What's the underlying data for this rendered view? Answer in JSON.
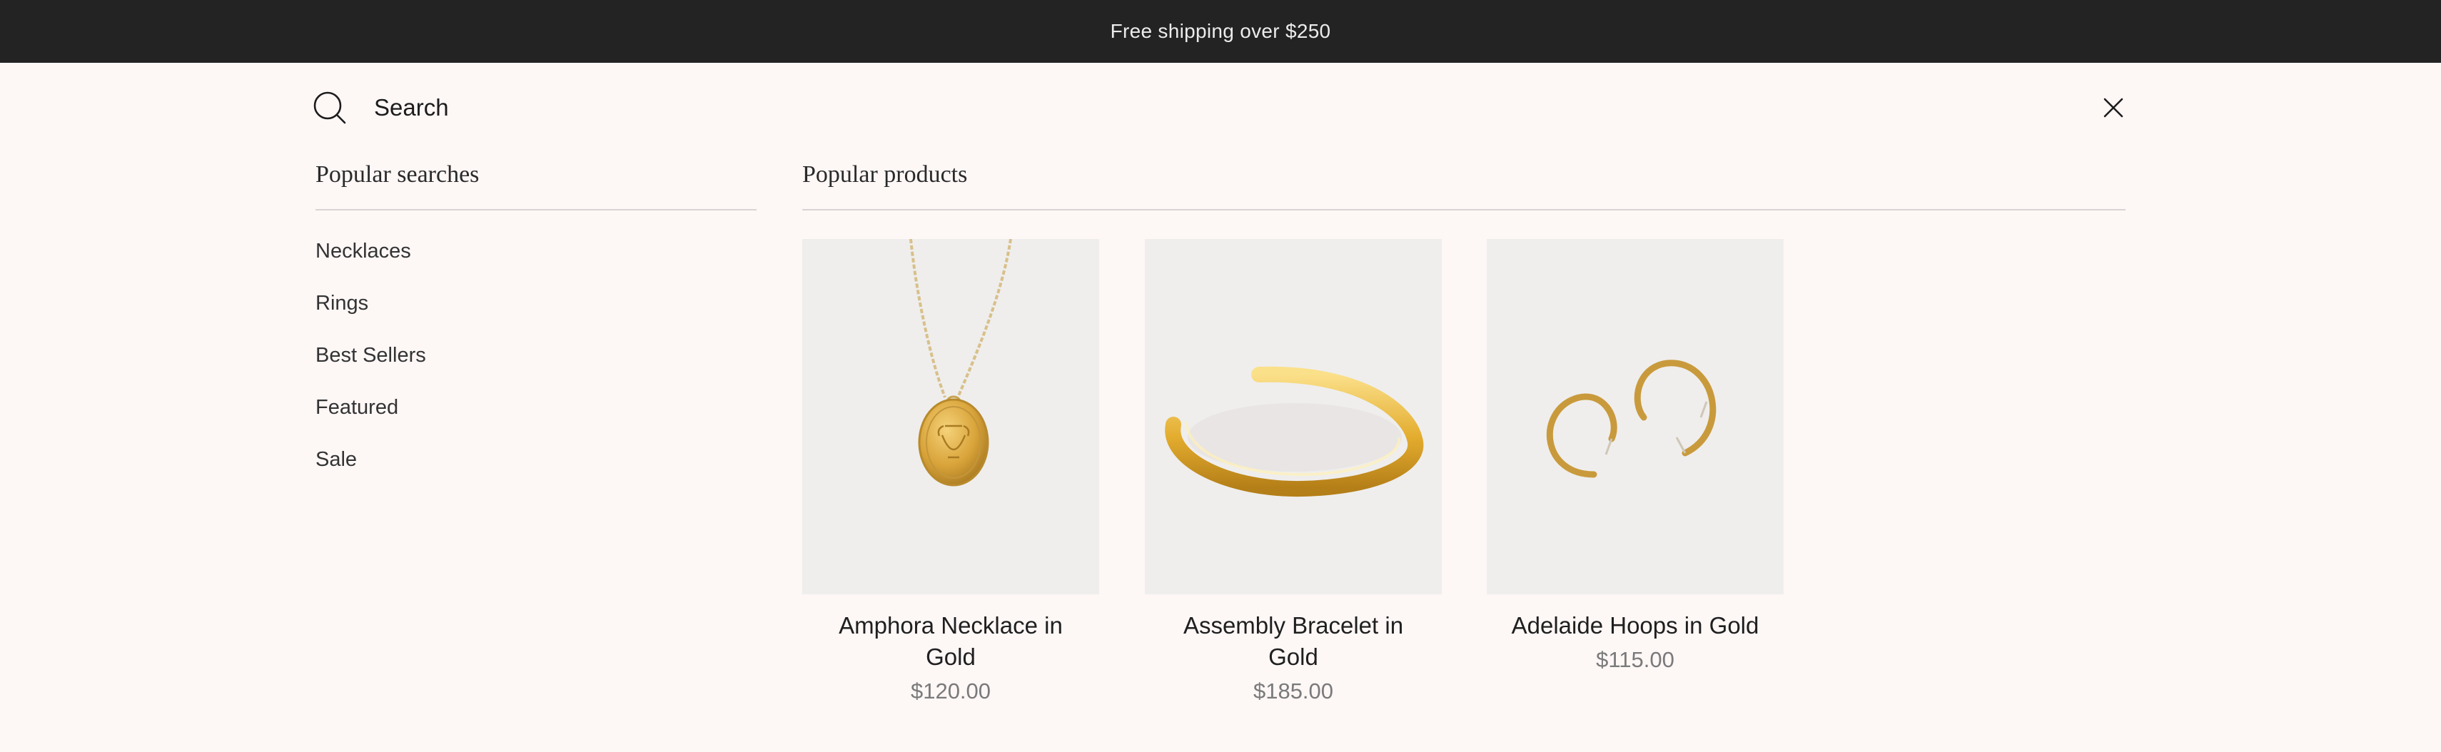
{
  "announcement": {
    "text": "Free shipping over $250"
  },
  "search": {
    "placeholder": "Search",
    "value": ""
  },
  "popular_searches": {
    "heading": "Popular searches",
    "items": [
      "Necklaces",
      "Rings",
      "Best Sellers",
      "Featured",
      "Sale"
    ]
  },
  "popular_products": {
    "heading": "Popular products",
    "items": [
      {
        "title": "Amphora Necklace in Gold",
        "price": "$120.00"
      },
      {
        "title": "Assembly Bracelet in Gold",
        "price": "$185.00"
      },
      {
        "title": "Adelaide Hoops in Gold",
        "price": "$115.00"
      }
    ]
  },
  "colors": {
    "announcement_bg": "#232323",
    "page_bg": "#fdf7f6",
    "gold": "#d9a43a"
  }
}
